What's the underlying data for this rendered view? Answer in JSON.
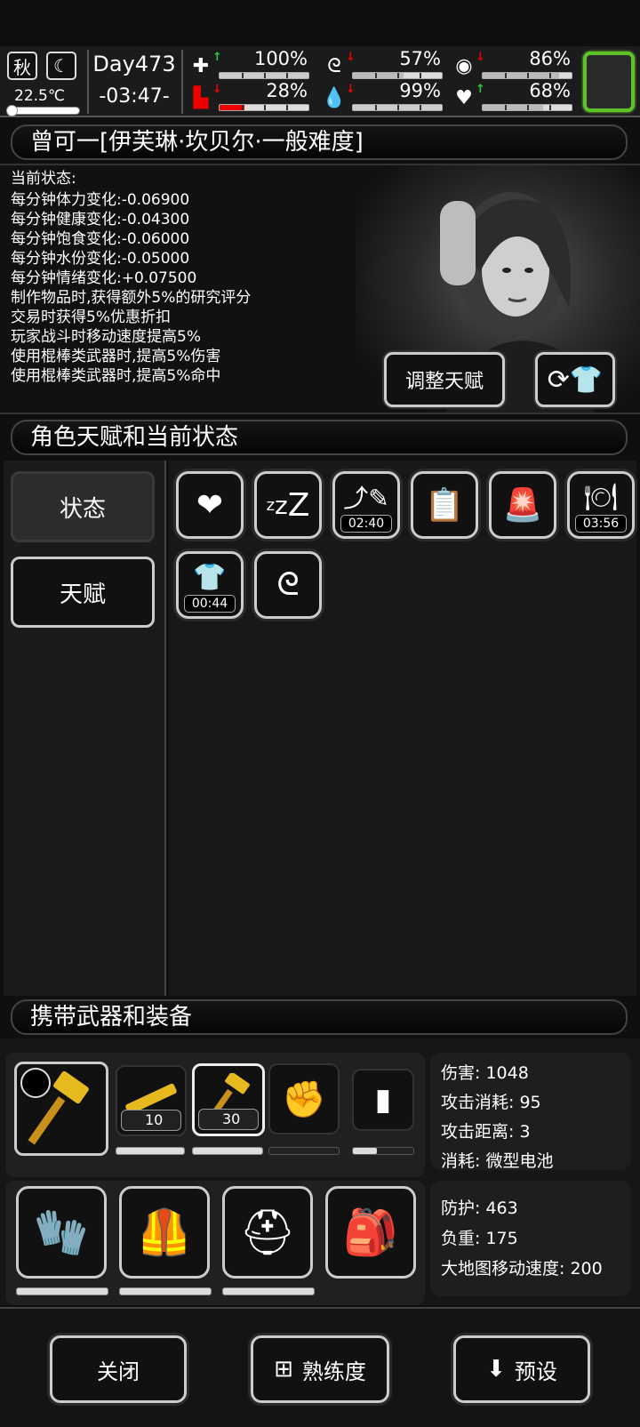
{
  "topbar": {
    "season": "秋",
    "moon_icon": "moon-icon",
    "temperature": "22.5℃",
    "day": "Day473",
    "time": "-03:47-",
    "stats": [
      {
        "icon": "medkit-icon",
        "trend": "up",
        "value": "100%",
        "fill": 1.0
      },
      {
        "icon": "stomach-icon",
        "trend": "down",
        "value": "57%",
        "fill": 0.57
      },
      {
        "icon": "mood-icon",
        "trend": "down",
        "value": "86%",
        "fill": 0.86
      },
      {
        "icon": "boot-icon",
        "trend": "down",
        "value": "28%",
        "fill": 0.28
      },
      {
        "icon": "water-drop-icon",
        "trend": "down",
        "value": "99%",
        "fill": 0.99
      },
      {
        "icon": "heart-icon",
        "trend": "up",
        "value": "68%",
        "fill": 0.68
      }
    ],
    "accent": "#5ec22a"
  },
  "character": {
    "title": "曾可一[伊芙琳·坎贝尔·一般难度]",
    "state_heading": "当前状态:",
    "lines": [
      "每分钟体力变化:-0.06900",
      "每分钟健康变化:-0.04300",
      "每分钟饱食变化:-0.06000",
      "每分钟水份变化:-0.05000",
      "每分钟情绪变化:+0.07500",
      "制作物品时,获得额外5%的研究评分",
      "交易时获得5%优惠折扣",
      "玩家战斗时移动速度提高5%",
      "使用棍棒类武器时,提高5%伤害",
      "使用棍棒类武器时,提高5%命中"
    ],
    "adjust_talent": "调整天赋"
  },
  "talents": {
    "header": "角色天赋和当前状态",
    "tab_status": "状态",
    "tab_talent": "天赋",
    "icons": [
      {
        "name": "heart-status-icon",
        "glyph": "❤",
        "timer": ""
      },
      {
        "name": "sleep-status-icon",
        "glyph": "zZZ",
        "timer": ""
      },
      {
        "name": "injection-status-icon",
        "glyph": "💉",
        "timer": "02:40"
      },
      {
        "name": "medicine-status-icon",
        "glyph": "💊",
        "timer": ""
      },
      {
        "name": "alarm-status-icon",
        "glyph": "🚨",
        "timer": ""
      },
      {
        "name": "meal-status-icon",
        "glyph": "🍽",
        "timer": "03:56"
      },
      {
        "name": "clothing-status-icon",
        "glyph": "👕",
        "timer": "00:44"
      },
      {
        "name": "stomach-status-icon",
        "glyph": "🫃",
        "timer": ""
      }
    ]
  },
  "equipment": {
    "header": "携带武器和装备",
    "weapons": [
      {
        "name": "hammer-weapon",
        "count": ""
      },
      {
        "name": "rifle-weapon",
        "count": "10"
      },
      {
        "name": "hammer-secondary",
        "count": "30"
      },
      {
        "name": "fist-weapon",
        "count": ""
      },
      {
        "name": "grenade-item",
        "count": ""
      }
    ],
    "durability": [
      1.0,
      1.0,
      0.0,
      0.4
    ],
    "weapon_stats": [
      "伤害: 1048",
      "攻击消耗: 95",
      "攻击距离: 3",
      "消耗: 微型电池"
    ],
    "armor_stats": [
      "防护: 463",
      "负重: 175",
      "大地图移动速度: 200"
    ],
    "armor_durability": [
      0.9,
      0.98,
      0.98
    ]
  },
  "bottom": {
    "close": "关闭",
    "proficiency": "熟练度",
    "preset": "预设"
  }
}
